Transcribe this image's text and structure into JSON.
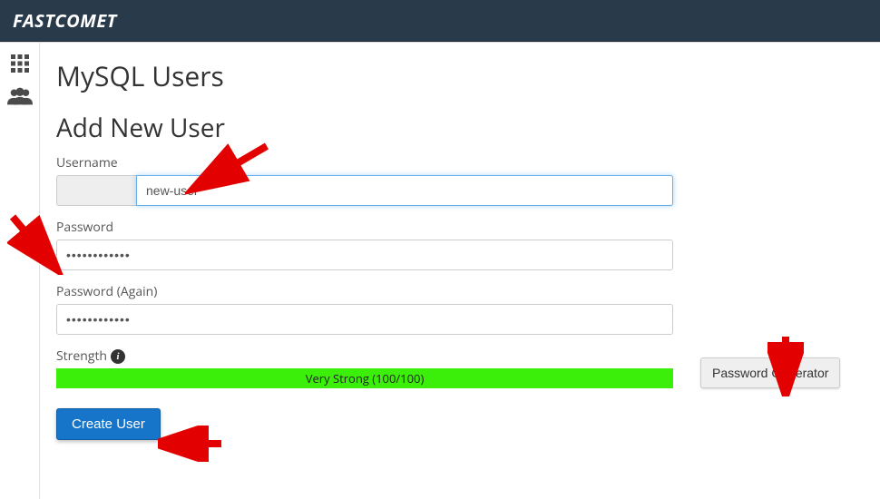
{
  "brand": "FASTCOMET",
  "page": {
    "title": "MySQL Users",
    "section": "Add New User"
  },
  "form": {
    "username_label": "Username",
    "username_value": "new-user",
    "password_label": "Password",
    "password_value": "••••••••••••",
    "password_again_label": "Password (Again)",
    "password_again_value": "••••••••••••",
    "strength_label": "Strength",
    "strength_text": "Very Strong (100/100)",
    "strength_color": "#3cef0a",
    "password_generator_label": "Password Generator",
    "submit_label": "Create User"
  }
}
